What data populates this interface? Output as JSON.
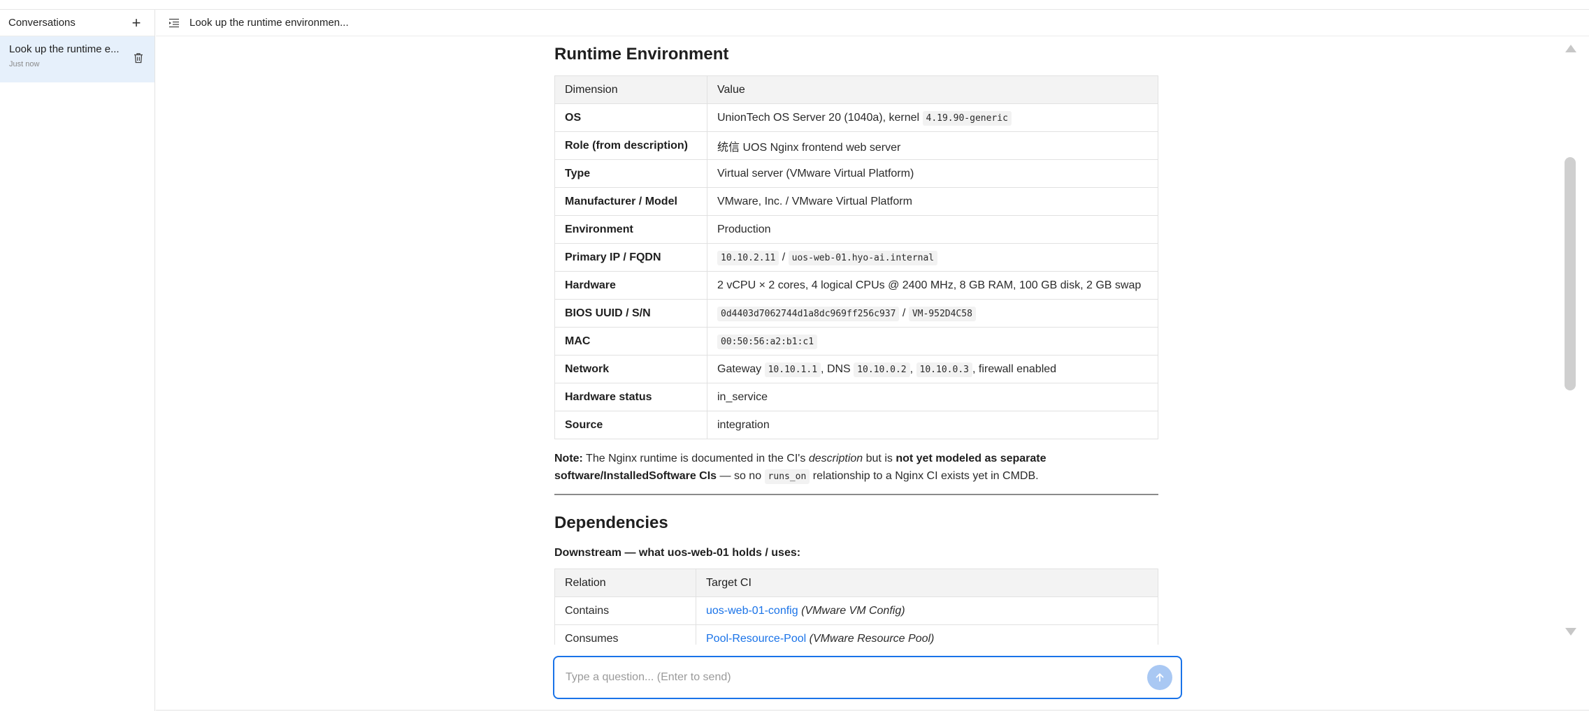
{
  "sidebar": {
    "title": "Conversations",
    "new_button": "+",
    "conversations": [
      {
        "title": "Look up the runtime e...",
        "time": "Just now"
      }
    ]
  },
  "header": {
    "title": "Look up the runtime environmen..."
  },
  "runtime": {
    "heading": "Runtime Environment",
    "col_dimension": "Dimension",
    "col_value": "Value",
    "rows": {
      "os": {
        "dim": "OS",
        "text": "UnionTech OS Server 20 (1040a), kernel",
        "kernel": "4.19.90-generic"
      },
      "role": {
        "dim": "Role (from description)",
        "value": "统信 UOS Nginx frontend web server"
      },
      "type": {
        "dim": "Type",
        "value": "Virtual server (VMware Virtual Platform)"
      },
      "manufacturer": {
        "dim": "Manufacturer / Model",
        "value": "VMware, Inc. / VMware Virtual Platform"
      },
      "environment": {
        "dim": "Environment",
        "value": "Production"
      },
      "ip": {
        "dim": "Primary IP / FQDN",
        "ip": "10.10.2.11",
        "sep": "/",
        "fqdn": "uos-web-01.hyo-ai.internal"
      },
      "hardware": {
        "dim": "Hardware",
        "value": "2 vCPU × 2 cores, 4 logical CPUs @ 2400 MHz, 8 GB RAM, 100 GB disk, 2 GB swap"
      },
      "bios": {
        "dim": "BIOS UUID / S/N",
        "uuid": "0d4403d7062744d1a8dc969ff256c937",
        "sep": "/",
        "sn": "VM-952D4C58"
      },
      "mac": {
        "dim": "MAC",
        "mac": "00:50:56:a2:b1:c1"
      },
      "network": {
        "dim": "Network",
        "pre": "Gateway",
        "gateway": "10.10.1.1",
        "dns_label": ", DNS",
        "dns1": "10.10.0.2",
        "comma": ",",
        "dns2": "10.10.0.3",
        "post": ", firewall enabled"
      },
      "hwstatus": {
        "dim": "Hardware status",
        "value": "in_service"
      },
      "source": {
        "dim": "Source",
        "value": "integration"
      }
    }
  },
  "note": {
    "label": "Note:",
    "t1": " The Nginx runtime is documented in the CI's ",
    "em": "description",
    "t2": " but is ",
    "bold": "not yet modeled as separate software/InstalledSoftware CIs",
    "t3": " — so no ",
    "code": "runs_on",
    "t4": " relationship to a Nginx CI exists yet in CMDB."
  },
  "dependencies": {
    "heading": "Dependencies",
    "downstream_label": "Downstream — what uos-web-01 holds / uses:",
    "col_relation": "Relation",
    "col_target": "Target CI",
    "rows": [
      {
        "relation": "Contains",
        "target": "uos-web-01-config",
        "type": "(VMware VM Config)"
      },
      {
        "relation": "Consumes",
        "target": "Pool-Resource-Pool",
        "type": "(VMware Resource Pool)"
      }
    ]
  },
  "input": {
    "placeholder": "Type a question... (Enter to send)"
  },
  "colors": {
    "accent": "#1a73e8",
    "selected_bg": "#e6f0fb",
    "send_button": "#a9c8f3"
  }
}
